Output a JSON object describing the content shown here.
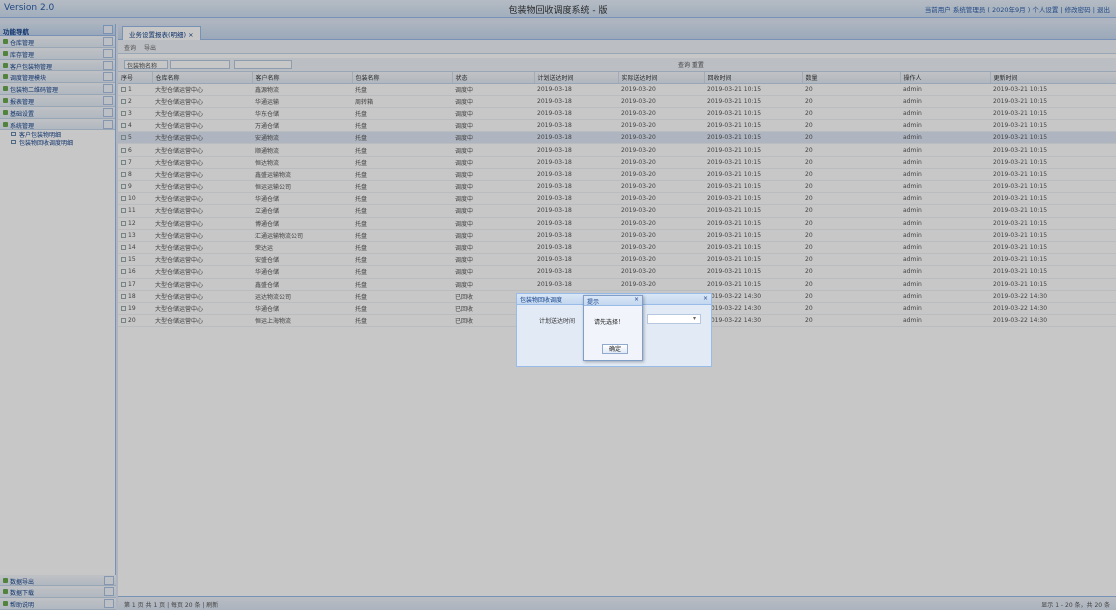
{
  "app": {
    "version": "Version 2.0",
    "title": "包装物回收调度系统 - 版",
    "header_right": "当前用户 系统管理员 ( 2020年9月 ) 个人设置 | 修改密码 | 退出"
  },
  "nav": {
    "header": "功能导航",
    "items": [
      {
        "label": "仓库管理"
      },
      {
        "label": "库存管理"
      },
      {
        "label": "客户包装物管理"
      },
      {
        "label": "调度管理模块"
      },
      {
        "label": "包装物二维码管理"
      },
      {
        "label": "报表管理"
      },
      {
        "label": "基础设置"
      },
      {
        "label": "系统管理"
      }
    ],
    "subitems": [
      {
        "label": "客户包装物明细"
      },
      {
        "label": "包装物回收调度明细"
      }
    ],
    "bottom_items": [
      {
        "label": "数据导出"
      },
      {
        "label": "数据下载"
      },
      {
        "label": "帮助说明"
      }
    ]
  },
  "main": {
    "tab": "业务设置报表(明细) ×",
    "toolbar": [
      "查询",
      "导出"
    ],
    "filter": {
      "label": "包装物名称",
      "range_sep": "至"
    },
    "filter_buttons": "查询 重置",
    "columns": [
      "序号",
      "仓库名称",
      "客户名称",
      "包装名称",
      "状态",
      "计划送达时间",
      "实际送达时间",
      "回收时间",
      "数量",
      "操作人",
      "更新时间"
    ],
    "rows": [
      [
        "1",
        "大型仓储运营中心",
        "鑫源物流",
        "托盘",
        "调度中",
        "2019-03-18",
        "2019-03-20",
        "2019-03-21 10:15",
        "20",
        "admin",
        "2019-03-21 10:15"
      ],
      [
        "2",
        "大型仓储运营中心",
        "华通运输",
        "周转箱",
        "调度中",
        "2019-03-18",
        "2019-03-20",
        "2019-03-21 10:15",
        "20",
        "admin",
        "2019-03-21 10:15"
      ],
      [
        "3",
        "大型仓储运营中心",
        "华东仓储",
        "托盘",
        "调度中",
        "2019-03-18",
        "2019-03-20",
        "2019-03-21 10:15",
        "20",
        "admin",
        "2019-03-21 10:15"
      ],
      [
        "4",
        "大型仓储运营中心",
        "万通仓储",
        "托盘",
        "调度中",
        "2019-03-18",
        "2019-03-20",
        "2019-03-21 10:15",
        "20",
        "admin",
        "2019-03-21 10:15"
      ],
      [
        "5",
        "大型仓储运营中心",
        "安通物流",
        "托盘",
        "调度中",
        "2019-03-18",
        "2019-03-20",
        "2019-03-21 10:15",
        "20",
        "admin",
        "2019-03-21 10:15"
      ],
      [
        "6",
        "大型仓储运营中心",
        "顺通物流",
        "托盘",
        "调度中",
        "2019-03-18",
        "2019-03-20",
        "2019-03-21 10:15",
        "20",
        "admin",
        "2019-03-21 10:15"
      ],
      [
        "7",
        "大型仓储运营中心",
        "恒达物流",
        "托盘",
        "调度中",
        "2019-03-18",
        "2019-03-20",
        "2019-03-21 10:15",
        "20",
        "admin",
        "2019-03-21 10:15"
      ],
      [
        "8",
        "大型仓储运营中心",
        "鑫盛运输物流",
        "托盘",
        "调度中",
        "2019-03-18",
        "2019-03-20",
        "2019-03-21 10:15",
        "20",
        "admin",
        "2019-03-21 10:15"
      ],
      [
        "9",
        "大型仓储运营中心",
        "恒运运输公司",
        "托盘",
        "调度中",
        "2019-03-18",
        "2019-03-20",
        "2019-03-21 10:15",
        "20",
        "admin",
        "2019-03-21 10:15"
      ],
      [
        "10",
        "大型仓储运营中心",
        "华通仓储",
        "托盘",
        "调度中",
        "2019-03-18",
        "2019-03-20",
        "2019-03-21 10:15",
        "20",
        "admin",
        "2019-03-21 10:15"
      ],
      [
        "11",
        "大型仓储运营中心",
        "立通仓储",
        "托盘",
        "调度中",
        "2019-03-18",
        "2019-03-20",
        "2019-03-21 10:15",
        "20",
        "admin",
        "2019-03-21 10:15"
      ],
      [
        "12",
        "大型仓储运营中心",
        "博通仓储",
        "托盘",
        "调度中",
        "2019-03-18",
        "2019-03-20",
        "2019-03-21 10:15",
        "20",
        "admin",
        "2019-03-21 10:15"
      ],
      [
        "13",
        "大型仓储运营中心",
        "汇通运输物流公司",
        "托盘",
        "调度中",
        "2019-03-18",
        "2019-03-20",
        "2019-03-21 10:15",
        "20",
        "admin",
        "2019-03-21 10:15"
      ],
      [
        "14",
        "大型仓储运营中心",
        "荣达运",
        "托盘",
        "调度中",
        "2019-03-18",
        "2019-03-20",
        "2019-03-21 10:15",
        "20",
        "admin",
        "2019-03-21 10:15"
      ],
      [
        "15",
        "大型仓储运营中心",
        "安盛仓储",
        "托盘",
        "调度中",
        "2019-03-18",
        "2019-03-20",
        "2019-03-21 10:15",
        "20",
        "admin",
        "2019-03-21 10:15"
      ],
      [
        "16",
        "大型仓储运营中心",
        "华通仓储",
        "托盘",
        "调度中",
        "2019-03-18",
        "2019-03-20",
        "2019-03-21 10:15",
        "20",
        "admin",
        "2019-03-21 10:15"
      ],
      [
        "17",
        "大型仓储运营中心",
        "鑫盛仓储",
        "托盘",
        "调度中",
        "2019-03-18",
        "2019-03-20",
        "2019-03-21 10:15",
        "20",
        "admin",
        "2019-03-21 10:15"
      ],
      [
        "18",
        "大型仓储运营中心",
        "运达物流公司",
        "托盘",
        "已回收",
        "2019-03-18",
        "2019-03-22",
        "2019-03-22 14:30",
        "20",
        "admin",
        "2019-03-22 14:30"
      ],
      [
        "19",
        "大型仓储运营中心",
        "华通仓储",
        "托盘",
        "已回收",
        "2019-03-18",
        "2019-03-22",
        "2019-03-22 14:30",
        "20",
        "admin",
        "2019-03-22 14:30"
      ],
      [
        "20",
        "大型仓储运营中心",
        "恒运上海物流",
        "托盘",
        "已回收",
        "2019-03-18",
        "2019-03-22",
        "2019-03-22 14:30",
        "20",
        "admin",
        "2019-03-22 14:30"
      ]
    ],
    "selected_row": 4,
    "pager_left": "第 1 页 共 1 页 | 每页 20 条 | 刷新",
    "pager_right": "显示 1 - 20 条，共 20 条"
  },
  "dialog": {
    "title": "包装物回收调度",
    "close": "×",
    "field_label": "计划送达时间",
    "select_arrow": "▾"
  },
  "alert": {
    "title": "提示",
    "close": "×",
    "message": "请先选择！",
    "ok_label": "确定"
  }
}
